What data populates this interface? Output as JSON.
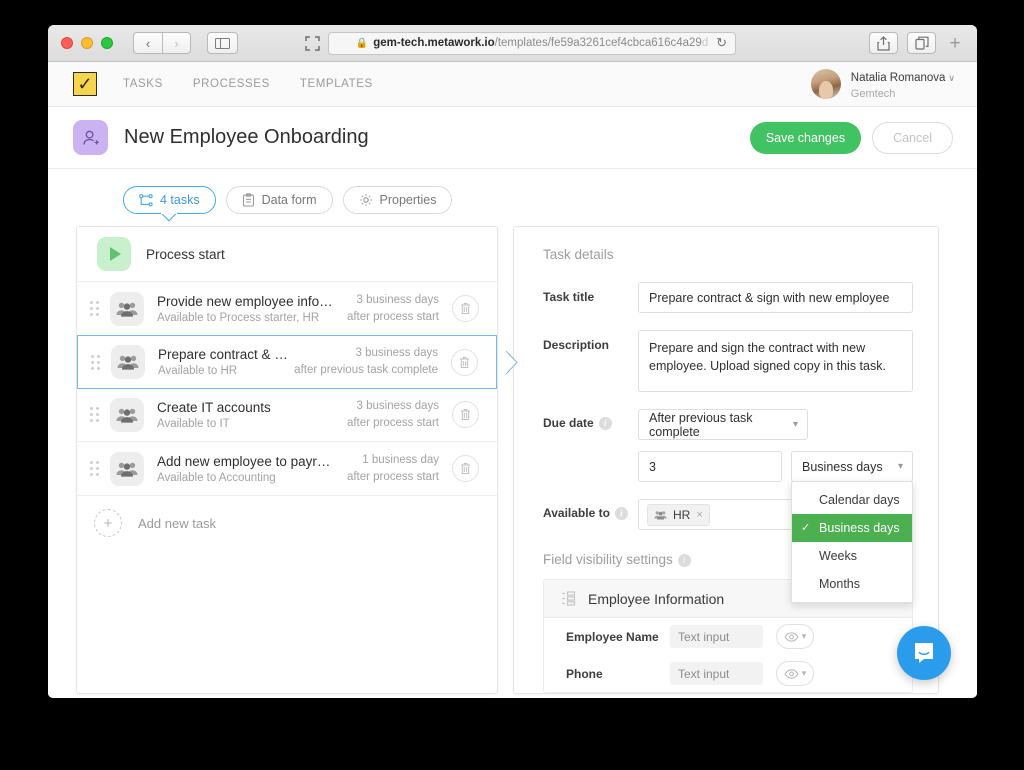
{
  "browser": {
    "url_lock": "lock-icon",
    "url_domain": "gem-tech.metawork.io",
    "url_path": "/templates/fe59a3261cef4cbca616c4a29",
    "url_fade": "d",
    "reload": "↻",
    "back": "‹",
    "forward": "›",
    "share": "share-icon",
    "tabs": "tabs-icon",
    "newtab": "+"
  },
  "appnav": {
    "logo": "✓",
    "links": [
      {
        "label": "TASKS"
      },
      {
        "label": "PROCESSES"
      },
      {
        "label": "TEMPLATES"
      }
    ],
    "profile": {
      "name": "Natalia Romanova",
      "company": "Gemtech",
      "caret": "∨"
    }
  },
  "page": {
    "title": "New Employee Onboarding",
    "save_label": "Save changes",
    "cancel_label": "Cancel"
  },
  "tabs": [
    {
      "label": "4 tasks",
      "icon": "flow-icon",
      "active": true
    },
    {
      "label": "Data form",
      "icon": "clipboard-icon",
      "active": false
    },
    {
      "label": "Properties",
      "icon": "gear-icon",
      "active": false
    }
  ],
  "process": {
    "start_label": "Process start",
    "add_task_label": "Add new task",
    "tasks": [
      {
        "name": "Provide new employee info…",
        "available": "Available to Process starter, HR",
        "due_amount": "3 business days",
        "due_when": "after process start",
        "selected": false
      },
      {
        "name": "Prepare contract & sign wit…",
        "available": "Available to HR",
        "due_amount": "3 business days",
        "due_when": "after previous task complete",
        "selected": true
      },
      {
        "name": "Create IT accounts",
        "available": "Available to IT",
        "due_amount": "3 business days",
        "due_when": "after process start",
        "selected": false
      },
      {
        "name": "Add new employee to payr…",
        "available": "Available to Accounting",
        "due_amount": "1 business day",
        "due_when": "after process start",
        "selected": false
      }
    ]
  },
  "details": {
    "header": "Task details",
    "task_title_label": "Task title",
    "task_title_value": "Prepare contract & sign with new employee",
    "description_label": "Description",
    "description_value": "Prepare and sign the contract with new employee. Upload signed copy in this task.",
    "due_date_label": "Due date",
    "due_date_value": "After previous task complete",
    "due_amount_value": "3",
    "due_unit_value": "Business days",
    "due_unit_options": [
      {
        "label": "Calendar days",
        "selected": false
      },
      {
        "label": "Business days",
        "selected": true
      },
      {
        "label": "Weeks",
        "selected": false
      },
      {
        "label": "Months",
        "selected": false
      }
    ],
    "available_to_label": "Available to",
    "available_to_tag": "HR",
    "available_to_tag_remove": "×",
    "field_visibility_label": "Field visibility settings",
    "form_card": {
      "title": "Employee Information",
      "rows": [
        {
          "label": "Employee Name",
          "input_placeholder": "Text input"
        },
        {
          "label": "Phone",
          "input_placeholder": "Text input"
        }
      ]
    }
  },
  "intercom": {
    "icon": "chat-bubble-icon"
  }
}
